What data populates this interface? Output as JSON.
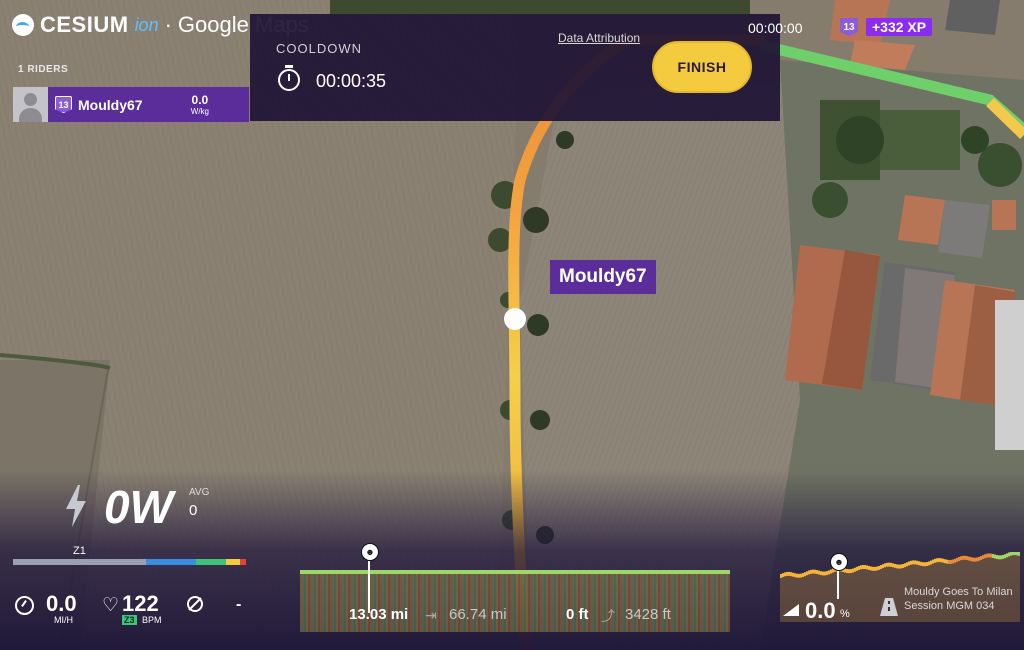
{
  "branding": {
    "cesium": "CESIUM",
    "ion": "ion",
    "separator": "·",
    "google": "Google Maps",
    "attribution": "Data Attribution"
  },
  "riders": {
    "title": "1 RIDERS",
    "list": [
      {
        "level": "13",
        "name": "Mouldy67",
        "watts_per_kg": "0.0",
        "unit": "W/kg"
      }
    ]
  },
  "workout": {
    "phase": "COOLDOWN",
    "timer": "00:00:35",
    "finish_label": "FINISH"
  },
  "status": {
    "elapsed": "00:00:00",
    "level": "13",
    "xp": "+332 XP"
  },
  "map": {
    "rider_label": "Mouldy67"
  },
  "power": {
    "value": "0W",
    "avg_label": "AVG",
    "avg_value": "0",
    "zone": "Z1",
    "zone_colors": [
      "#9aa0b4",
      "#3a8ee0",
      "#3cc47a",
      "#f4cb3e",
      "#e2453c"
    ]
  },
  "speed": {
    "value": "0.0",
    "unit": "MI/H"
  },
  "heart_rate": {
    "value": "122",
    "zone": "Z3",
    "unit": "BPM"
  },
  "cadence": {
    "value": "-"
  },
  "route": {
    "distance_done": "13.03 mi",
    "distance_total": "66.74 mi",
    "elevation_done": "0 ft",
    "elevation_total": "3428 ft",
    "gradient": "0.0",
    "gradient_unit": "%",
    "name": "Mouldy Goes To Milan Session MGM 034"
  },
  "icons": {
    "timer": "stopwatch-icon",
    "power": "lightning-icon",
    "speed": "speedometer-icon",
    "heart": "heart-rate-icon",
    "cadence": "cadence-icon",
    "slope": "slope-icon",
    "road": "road-icon",
    "rider_marker": "rider-marker-icon"
  }
}
